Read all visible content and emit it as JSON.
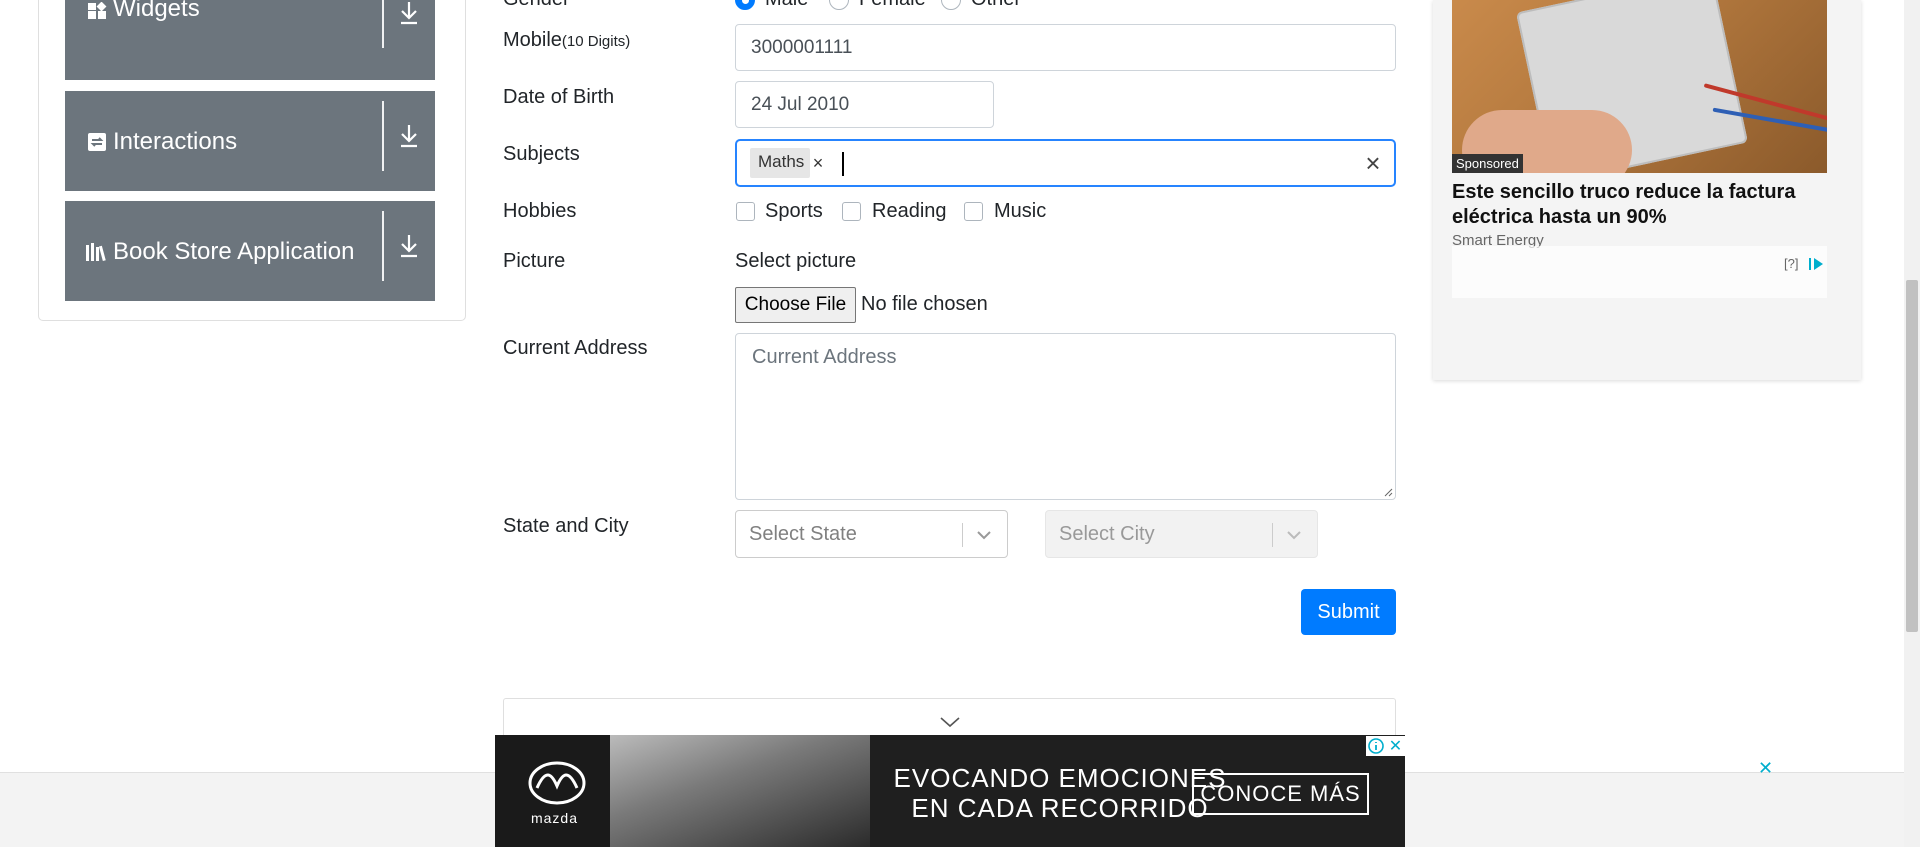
{
  "sidebar": {
    "groups": [
      {
        "label": "Widgets",
        "icon": "widgets-icon"
      },
      {
        "label": "Interactions",
        "icon": "interactions-icon"
      },
      {
        "label": "Book Store Application",
        "icon": "book-store-icon"
      }
    ]
  },
  "form": {
    "gender": {
      "label": "Gender",
      "options": [
        "Male",
        "Female",
        "Other"
      ],
      "selected": "Male"
    },
    "mobile": {
      "label": "Mobile",
      "hint": "(10 Digits)",
      "value": "3000001111"
    },
    "dob": {
      "label": "Date of Birth",
      "value": "24 Jul 2010"
    },
    "subjects": {
      "label": "Subjects",
      "chips": [
        "Maths"
      ],
      "chip_remove": "×",
      "clear": "×"
    },
    "hobbies": {
      "label": "Hobbies",
      "options": [
        "Sports",
        "Reading",
        "Music"
      ]
    },
    "picture": {
      "label": "Picture",
      "select_text": "Select picture",
      "button": "Choose File",
      "status": "No file chosen"
    },
    "address": {
      "label": "Current Address",
      "placeholder": "Current Address"
    },
    "state_city": {
      "label": "State and City",
      "state_placeholder": "Select State",
      "city_placeholder": "Select City"
    },
    "submit": "Submit"
  },
  "right_ad": {
    "badge": "Sponsored",
    "title": "Este sencillo truco reduce la factura eléctrica hasta un 90%",
    "source": "Smart Energy",
    "help": "[?]"
  },
  "bottom_ad": {
    "brand": "mazda",
    "line1": "EVOCANDO EMOCIONES",
    "line2": "EN CADA RECORRIDO",
    "cta": "CONOCE MÁS",
    "close": "✕",
    "bar_close": "✕"
  },
  "colors": {
    "primary": "#007bff",
    "sidebar_group": "#6c757d",
    "focus_border": "#2684ff",
    "ad_accent": "#00aecd"
  }
}
